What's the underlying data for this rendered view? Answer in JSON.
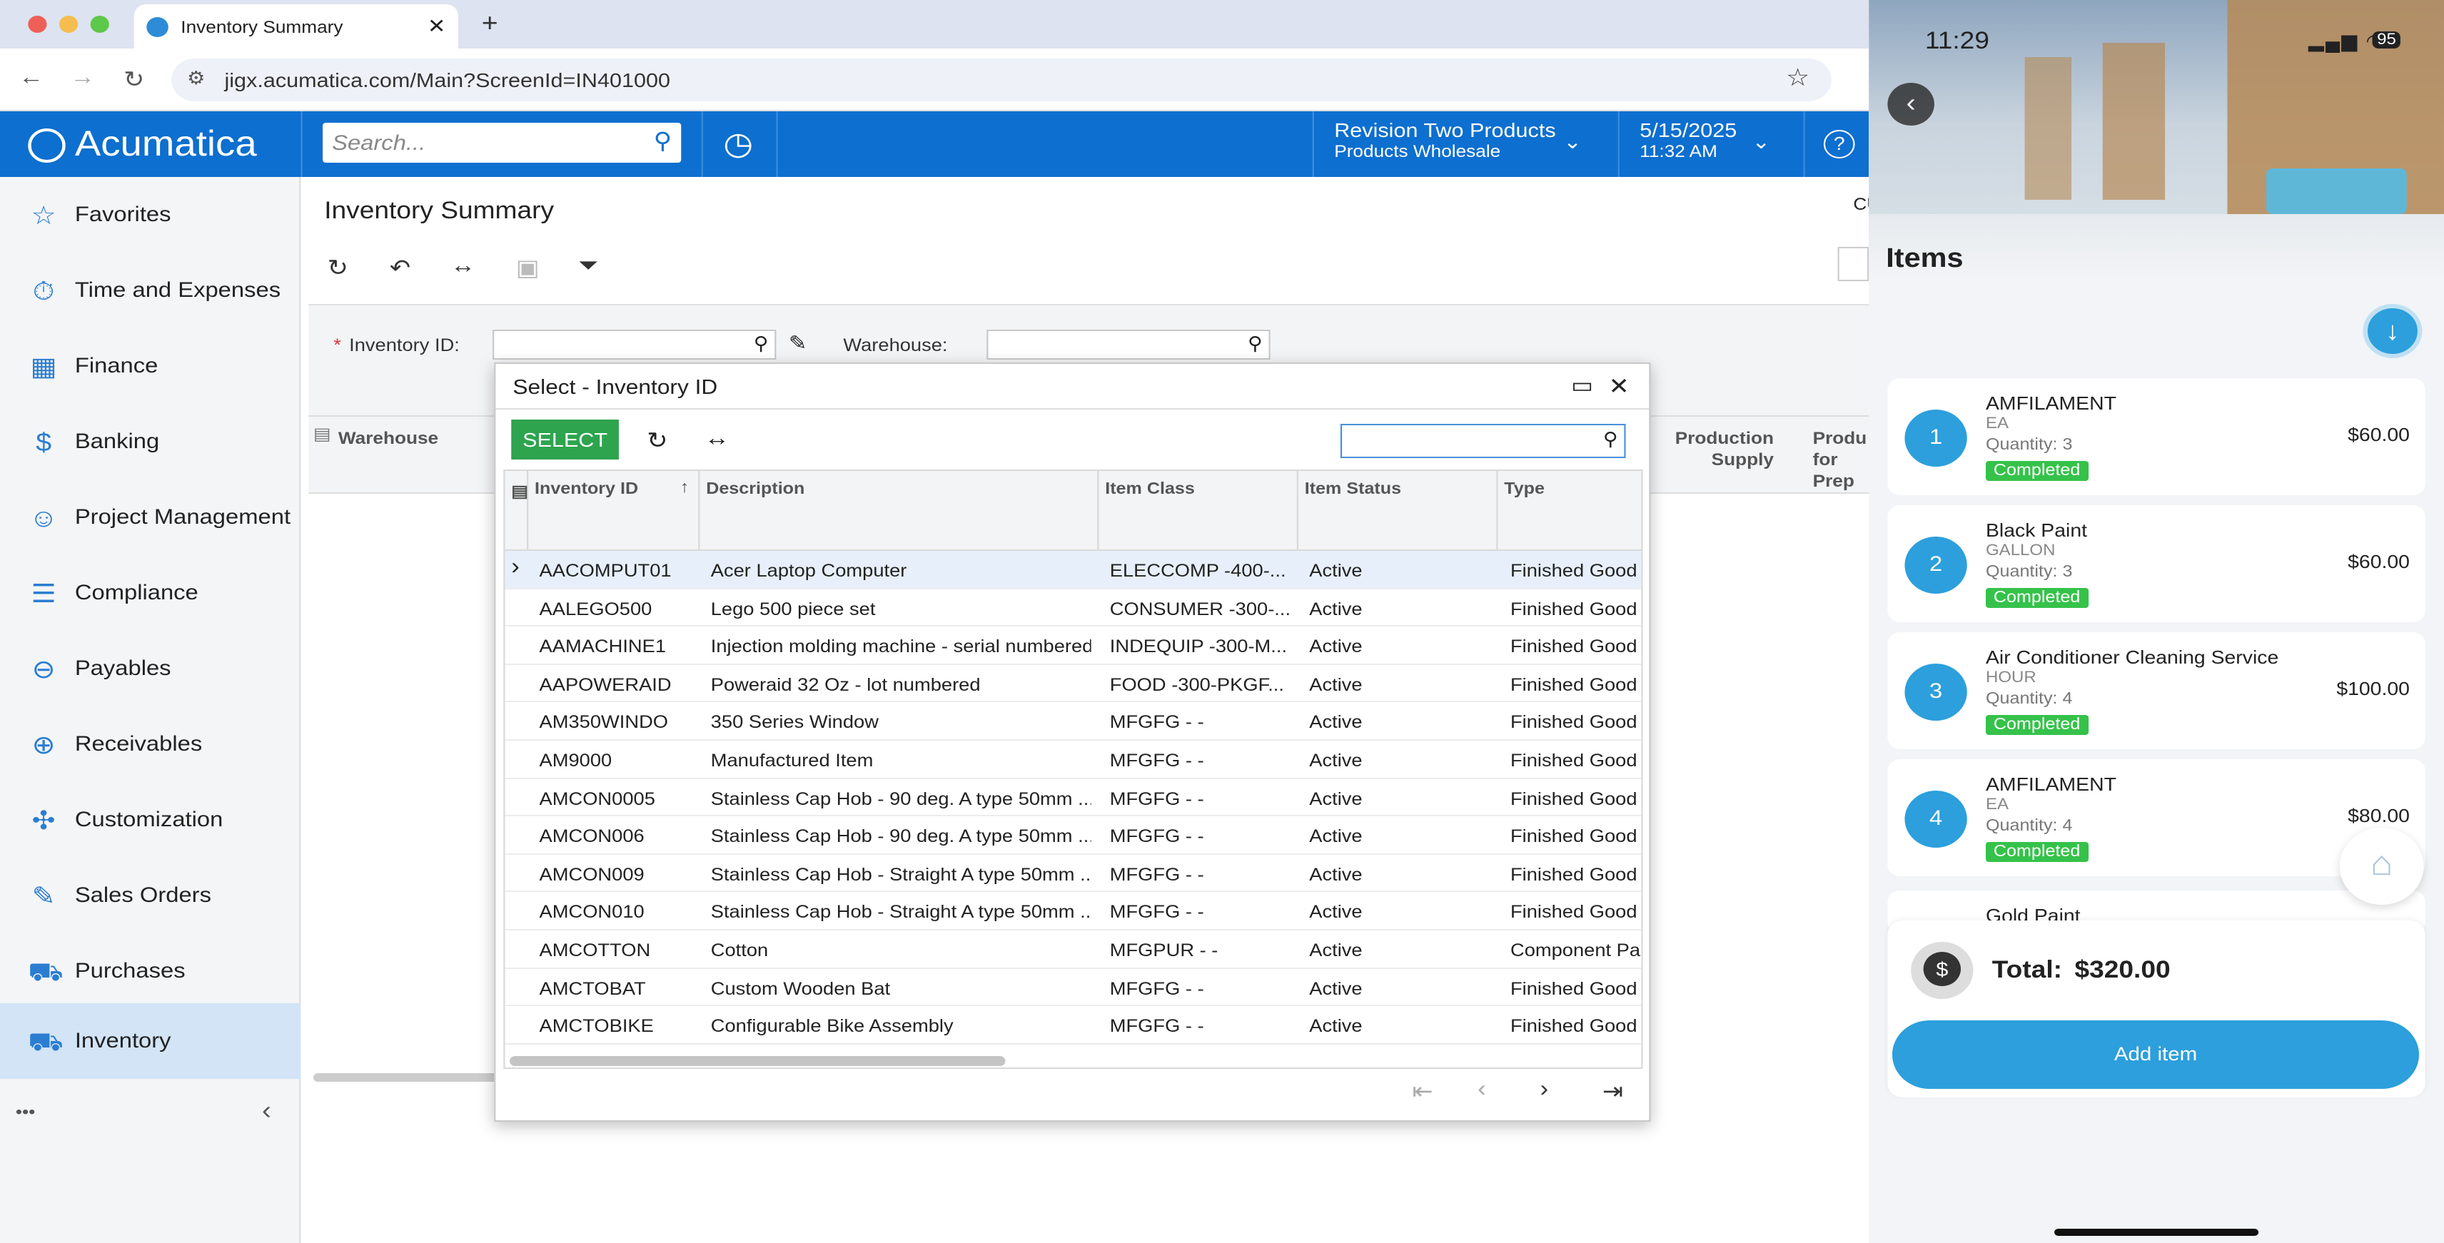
{
  "browser": {
    "tab_title": "Inventory Summary",
    "url": "jigx.acumatica.com/Main?ScreenId=IN401000"
  },
  "header": {
    "logo": "Acumatica",
    "search_placeholder": "Search...",
    "company_name": "Revision Two Products",
    "company_branch": "Products Wholesale",
    "date": "5/15/2025",
    "time": "11:32 AM",
    "help": "?"
  },
  "sidebar": {
    "items": [
      "Favorites",
      "Time and Expenses",
      "Finance",
      "Banking",
      "Project Management",
      "Compliance",
      "Payables",
      "Receivables",
      "Customization",
      "Sales Orders",
      "Purchases",
      "Inventory"
    ],
    "more": "•••",
    "collapse": "‹"
  },
  "page": {
    "title": "Inventory Summary",
    "inventory_label": "Inventory ID:",
    "required_mark": "*",
    "warehouse_label": "Warehouse:",
    "right_partial": "CU",
    "col_warehouse": "Warehouse",
    "col_production_supply": "Production Supply",
    "col_prod_for_prep": "Produ for Prep"
  },
  "dialog": {
    "title": "Select - Inventory ID",
    "select_label": "SELECT",
    "columns": [
      "Inventory ID",
      "Description",
      "Item Class",
      "Item Status",
      "Type"
    ],
    "rows": [
      [
        "AACOMPUT01",
        "Acer Laptop Computer",
        "ELECCOMP -400-...",
        "Active",
        "Finished Good"
      ],
      [
        "AALEGO500",
        "Lego 500 piece set",
        "CONSUMER -300-...",
        "Active",
        "Finished Good"
      ],
      [
        "AAMACHINE1",
        "Injection molding machine - serial numbered",
        "INDEQUIP -300-M...",
        "Active",
        "Finished Good"
      ],
      [
        "AAPOWERAID",
        "Poweraid 32 Oz - lot numbered",
        "FOOD -300-PKGF...",
        "Active",
        "Finished Good"
      ],
      [
        "AM350WINDO",
        "350 Series Window",
        "MFGFG - -",
        "Active",
        "Finished Good"
      ],
      [
        "AM9000",
        "Manufactured Item",
        "MFGFG - -",
        "Active",
        "Finished Good"
      ],
      [
        "AMCON0005",
        "Stainless Cap Hob - 90 deg. A type 50mm ...",
        "MFGFG - -",
        "Active",
        "Finished Good"
      ],
      [
        "AMCON006",
        "Stainless Cap Hob - 90 deg. A type 50mm ...",
        "MFGFG - -",
        "Active",
        "Finished Good"
      ],
      [
        "AMCON009",
        "Stainless Cap Hob - Straight A type 50mm ...",
        "MFGFG - -",
        "Active",
        "Finished Good"
      ],
      [
        "AMCON010",
        "Stainless Cap Hob - Straight A type 50mm ...",
        "MFGFG - -",
        "Active",
        "Finished Good"
      ],
      [
        "AMCOTTON",
        "Cotton",
        "MFGPUR - -",
        "Active",
        "Component Part"
      ],
      [
        "AMCTOBAT",
        "Custom Wooden Bat",
        "MFGFG - -",
        "Active",
        "Finished Good"
      ],
      [
        "AMCTOBIKE",
        "Configurable Bike Assembly",
        "MFGFG - -",
        "Active",
        "Finished Good"
      ]
    ]
  },
  "mobile": {
    "time": "11:29",
    "battery": "95",
    "title": "Items",
    "items": [
      {
        "num": "1",
        "name": "AMFILAMENT",
        "unit": "EA",
        "qty": "Quantity: 3",
        "status": "Completed",
        "price": "$60.00"
      },
      {
        "num": "2",
        "name": "Black Paint",
        "unit": "GALLON",
        "qty": "Quantity: 3",
        "status": "Completed",
        "price": "$60.00"
      },
      {
        "num": "3",
        "name": "Air Conditioner Cleaning Service",
        "unit": "HOUR",
        "qty": "Quantity: 4",
        "status": "Completed",
        "price": "$100.00"
      },
      {
        "num": "4",
        "name": "AMFILAMENT",
        "unit": "EA",
        "qty": "Quantity: 4",
        "status": "Completed",
        "price": "$80.00"
      }
    ],
    "partial_item": "Gold Paint",
    "total_label": "Total:",
    "total_value": "$320.00",
    "add_label": "Add item"
  },
  "colors": {
    "brand": "#0d6fcf",
    "select_green": "#2ea44f",
    "badge_blue": "#2c9fdc",
    "status_green": "#35c24a"
  }
}
